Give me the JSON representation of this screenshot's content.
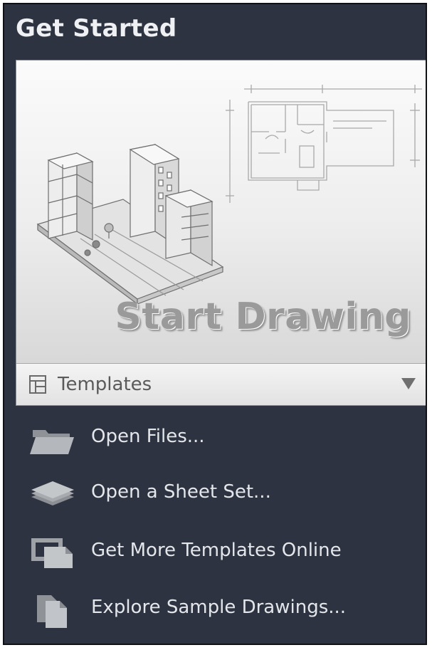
{
  "panel": {
    "title": "Get Started"
  },
  "start_card": {
    "label": "Start Drawing",
    "illustration": "building-and-floorplan-illustration"
  },
  "templates": {
    "label": "Templates",
    "icon": "template-grid-icon",
    "caret": "dropdown-caret-icon"
  },
  "actions": [
    {
      "label": "Open Files...",
      "icon": "folder-icon"
    },
    {
      "label": "Open a Sheet Set...",
      "icon": "sheet-set-icon"
    },
    {
      "label": "Get More Templates Online",
      "icon": "templates-online-icon"
    },
    {
      "label": "Explore Sample Drawings...",
      "icon": "sample-drawings-icon"
    }
  ],
  "colors": {
    "panel_background": "#2d3340",
    "title_text": "#eef0f3",
    "action_text": "#e3e6ea",
    "card_text": "#9a9a9a"
  }
}
